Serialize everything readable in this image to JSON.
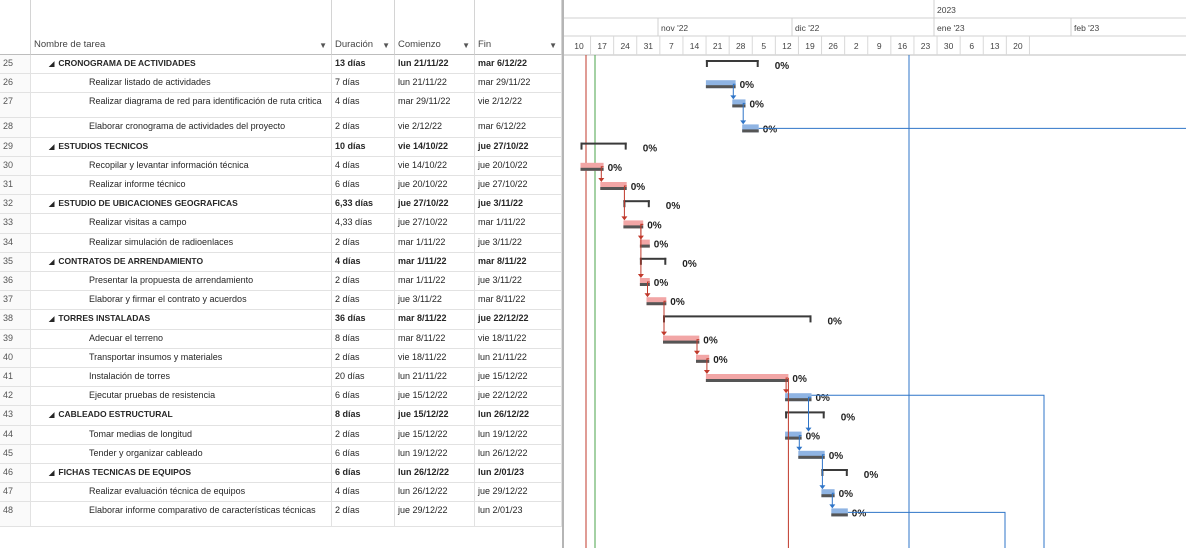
{
  "columns": {
    "name": "Nombre de tarea",
    "duration": "Duración",
    "start": "Comienzo",
    "end": "Fin"
  },
  "timeline": {
    "years": [
      "2023"
    ],
    "months": [
      "nov '22",
      "dic '22",
      "ene '23",
      "feb '23"
    ],
    "days": [
      "10",
      "17",
      "24",
      "31",
      "7",
      "14",
      "21",
      "28",
      "5",
      "12",
      "19",
      "26",
      "2",
      "9",
      "16",
      "23",
      "30",
      "6",
      "13",
      "20"
    ]
  },
  "tasks": [
    {
      "id": "25",
      "name": "CRONOGRAMA DE ACTIVIDADES",
      "duration": "13 días",
      "start": "lun 21/11/22",
      "end": "mar 6/12/22",
      "summary": true,
      "pct": "0%"
    },
    {
      "id": "26",
      "name": "Realizar listado de actividades",
      "duration": "7 días",
      "start": "lun 21/11/22",
      "end": "mar 29/11/22",
      "summary": false,
      "pct": "0%"
    },
    {
      "id": "27",
      "name": "Realizar diagrama de red para identificación de ruta critica",
      "duration": "4 días",
      "start": "mar 29/11/22",
      "end": "vie 2/12/22",
      "summary": false,
      "pct": "0%"
    },
    {
      "id": "28",
      "name": "Elaborar cronograma de actividades del proyecto",
      "duration": "2 días",
      "start": "vie 2/12/22",
      "end": "mar 6/12/22",
      "summary": false,
      "pct": "0%"
    },
    {
      "id": "29",
      "name": "ESTUDIOS TECNICOS",
      "duration": "10 días",
      "start": "vie 14/10/22",
      "end": "jue 27/10/22",
      "summary": true,
      "pct": "0%"
    },
    {
      "id": "30",
      "name": "Recopilar y levantar información técnica",
      "duration": "4 días",
      "start": "vie 14/10/22",
      "end": "jue 20/10/22",
      "summary": false,
      "pct": "0%"
    },
    {
      "id": "31",
      "name": "Realizar informe técnico",
      "duration": "6 días",
      "start": "jue 20/10/22",
      "end": "jue 27/10/22",
      "summary": false,
      "pct": "0%"
    },
    {
      "id": "32",
      "name": "ESTUDIO DE UBICACIONES GEOGRAFICAS",
      "duration": "6,33 días",
      "start": "jue 27/10/22",
      "end": "jue 3/11/22",
      "summary": true,
      "pct": "0%"
    },
    {
      "id": "33",
      "name": "Realizar visitas a campo",
      "duration": "4,33 días",
      "start": "jue 27/10/22",
      "end": "mar 1/11/22",
      "summary": false,
      "pct": "0%"
    },
    {
      "id": "34",
      "name": "Realizar simulación de radioenlaces",
      "duration": "2 días",
      "start": "mar 1/11/22",
      "end": "jue 3/11/22",
      "summary": false,
      "pct": "0%"
    },
    {
      "id": "35",
      "name": "CONTRATOS DE ARRENDAMIENTO",
      "duration": "4 días",
      "start": "mar 1/11/22",
      "end": "mar 8/11/22",
      "summary": true,
      "pct": "0%"
    },
    {
      "id": "36",
      "name": "Presentar la propuesta de arrendamiento",
      "duration": "2 días",
      "start": "mar 1/11/22",
      "end": "jue 3/11/22",
      "summary": false,
      "pct": "0%"
    },
    {
      "id": "37",
      "name": "Elaborar y firmar el contrato y acuerdos",
      "duration": "2 días",
      "start": "jue 3/11/22",
      "end": "mar 8/11/22",
      "summary": false,
      "pct": "0%"
    },
    {
      "id": "38",
      "name": "TORRES INSTALADAS",
      "duration": "36 días",
      "start": "mar 8/11/22",
      "end": "jue 22/12/22",
      "summary": true,
      "pct": "0%"
    },
    {
      "id": "39",
      "name": "Adecuar el terreno",
      "duration": "8 días",
      "start": "mar 8/11/22",
      "end": "vie 18/11/22",
      "summary": false,
      "pct": "0%"
    },
    {
      "id": "40",
      "name": "Transportar insumos y materiales",
      "duration": "2 días",
      "start": "vie 18/11/22",
      "end": "lun 21/11/22",
      "summary": false,
      "pct": "0%"
    },
    {
      "id": "41",
      "name": "Instalación de torres",
      "duration": "20 días",
      "start": "lun 21/11/22",
      "end": "jue 15/12/22",
      "summary": false,
      "pct": "0%"
    },
    {
      "id": "42",
      "name": "Ejecutar pruebas de resistencia",
      "duration": "6 días",
      "start": "jue 15/12/22",
      "end": "jue 22/12/22",
      "summary": false,
      "pct": "0%"
    },
    {
      "id": "43",
      "name": "CABLEADO ESTRUCTURAL",
      "duration": "8 días",
      "start": "jue 15/12/22",
      "end": "lun 26/12/22",
      "summary": true,
      "pct": "0%"
    },
    {
      "id": "44",
      "name": "Tomar medias de longitud",
      "duration": "2 días",
      "start": "jue 15/12/22",
      "end": "lun 19/12/22",
      "summary": false,
      "pct": "0%"
    },
    {
      "id": "45",
      "name": "Tender y organizar cableado",
      "duration": "6 días",
      "start": "lun 19/12/22",
      "end": "lun 26/12/22",
      "summary": false,
      "pct": "0%"
    },
    {
      "id": "46",
      "name": "FICHAS TECNICAS DE EQUIPOS",
      "duration": "6 días",
      "start": "lun 26/12/22",
      "end": "lun 2/01/23",
      "summary": true,
      "pct": "0%"
    },
    {
      "id": "47",
      "name": "Realizar evaluación técnica de equipos",
      "duration": "4 días",
      "start": "lun 26/12/22",
      "end": "jue 29/12/22",
      "summary": false,
      "pct": "0%"
    },
    {
      "id": "48",
      "name": "Elaborar informe comparativo de características técnicas",
      "duration": "2 días",
      "start": "jue 29/12/22",
      "end": "lun 2/01/23",
      "summary": false,
      "pct": "0%"
    }
  ],
  "colors": {
    "critical": "#f2a6a6",
    "normal": "#8fb4e3",
    "summary": "#3a3a3a",
    "progress": "#555555",
    "link_red": "#c0392b",
    "link_blue": "#2f75c8",
    "today_line": "#4aa34a",
    "status_line": "#2f75c8"
  }
}
